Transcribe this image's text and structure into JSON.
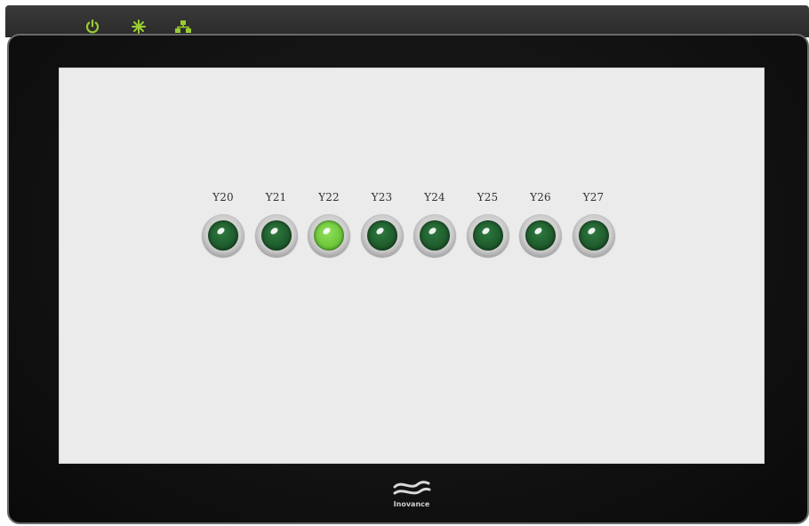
{
  "hmi": {
    "status_icons": [
      {
        "name": "power-icon",
        "color": "#9acd32"
      },
      {
        "name": "run-sparkle-icon",
        "color": "#9acd32"
      },
      {
        "name": "network-icon",
        "color": "#9acd32"
      }
    ],
    "lamps": [
      {
        "label": "Y20",
        "state": "off"
      },
      {
        "label": "Y21",
        "state": "off"
      },
      {
        "label": "Y22",
        "state": "on"
      },
      {
        "label": "Y23",
        "state": "off"
      },
      {
        "label": "Y24",
        "state": "off"
      },
      {
        "label": "Y25",
        "state": "off"
      },
      {
        "label": "Y26",
        "state": "off"
      },
      {
        "label": "Y27",
        "state": "off"
      }
    ],
    "lamp_colors": {
      "off": "#1e5a2c",
      "on": "#6cc63a"
    },
    "brand": "Inovance"
  }
}
